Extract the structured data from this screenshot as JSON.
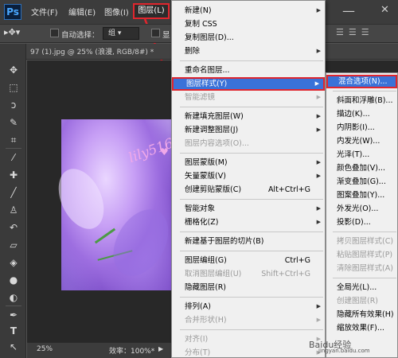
{
  "app": {
    "logo": "Ps"
  },
  "menubar": {
    "items": [
      "文件(F)",
      "编辑(E)",
      "图像(I)"
    ],
    "active": "图层(L)",
    "minimize": "—",
    "close": "✕"
  },
  "options": {
    "auto_select_label": "自动选择：",
    "auto_select_value": "组",
    "extra_label": "显"
  },
  "document": {
    "tab_title": "97 (1).jpg @ 25% (浪漫, RGB/8#) *",
    "zoom": "25%",
    "efficiency": "效率：100%*",
    "watermark": "lily51688"
  },
  "layer_menu": [
    {
      "label": "新建(N)",
      "arrow": true
    },
    {
      "label": "复制 CSS"
    },
    {
      "label": "复制图层(D)..."
    },
    {
      "label": "删除",
      "arrow": true
    },
    {
      "sep": true
    },
    {
      "label": "重命名图层..."
    },
    {
      "label": "图层样式(Y)",
      "arrow": true,
      "highlight": true
    },
    {
      "label": "智能滤镜",
      "arrow": true,
      "disabled": true
    },
    {
      "sep": true
    },
    {
      "label": "新建填充图层(W)",
      "arrow": true
    },
    {
      "label": "新建调整图层(J)",
      "arrow": true
    },
    {
      "label": "图层内容选项(O)...",
      "disabled": true
    },
    {
      "sep": true
    },
    {
      "label": "图层蒙版(M)",
      "arrow": true
    },
    {
      "label": "矢量蒙版(V)",
      "arrow": true
    },
    {
      "label": "创建剪贴蒙版(C)",
      "shortcut": "Alt+Ctrl+G"
    },
    {
      "sep": true
    },
    {
      "label": "智能对象",
      "arrow": true
    },
    {
      "label": "栅格化(Z)",
      "arrow": true
    },
    {
      "sep": true
    },
    {
      "label": "新建基于图层的切片(B)"
    },
    {
      "sep": true
    },
    {
      "label": "图层编组(G)",
      "shortcut": "Ctrl+G"
    },
    {
      "label": "取消图层编组(U)",
      "shortcut": "Shift+Ctrl+G",
      "disabled": true
    },
    {
      "label": "隐藏图层(R)"
    },
    {
      "sep": true
    },
    {
      "label": "排列(A)",
      "arrow": true
    },
    {
      "label": "合并形状(H)",
      "arrow": true,
      "disabled": true
    },
    {
      "sep": true
    },
    {
      "label": "对齐(I)",
      "arrow": true,
      "disabled": true
    },
    {
      "label": "分布(T)",
      "arrow": true,
      "disabled": true
    }
  ],
  "style_submenu": [
    {
      "label": "混合选项(N)...",
      "highlight": true
    },
    {
      "sep": true
    },
    {
      "label": "斜面和浮雕(B)..."
    },
    {
      "label": "描边(K)..."
    },
    {
      "label": "内阴影(I)..."
    },
    {
      "label": "内发光(W)..."
    },
    {
      "label": "光泽(T)..."
    },
    {
      "label": "颜色叠加(V)..."
    },
    {
      "label": "渐变叠加(G)..."
    },
    {
      "label": "图案叠加(Y)..."
    },
    {
      "label": "外发光(O)..."
    },
    {
      "label": "投影(D)..."
    },
    {
      "sep": true
    },
    {
      "label": "拷贝图层样式(C)",
      "disabled": true
    },
    {
      "label": "粘贴图层样式(P)",
      "disabled": true
    },
    {
      "label": "清除图层样式(A)",
      "disabled": true
    },
    {
      "sep": true
    },
    {
      "label": "全局光(L)..."
    },
    {
      "label": "创建图层(R)",
      "disabled": true
    },
    {
      "label": "隐藏所有效果(H)"
    },
    {
      "label": "缩放效果(F)..."
    }
  ],
  "watermark_site": {
    "brand": "Baidu经验",
    "url": "jingyan.baidu.com"
  },
  "colors": {
    "highlight": "#3a72d8",
    "annotation_red": "#e0262e"
  }
}
